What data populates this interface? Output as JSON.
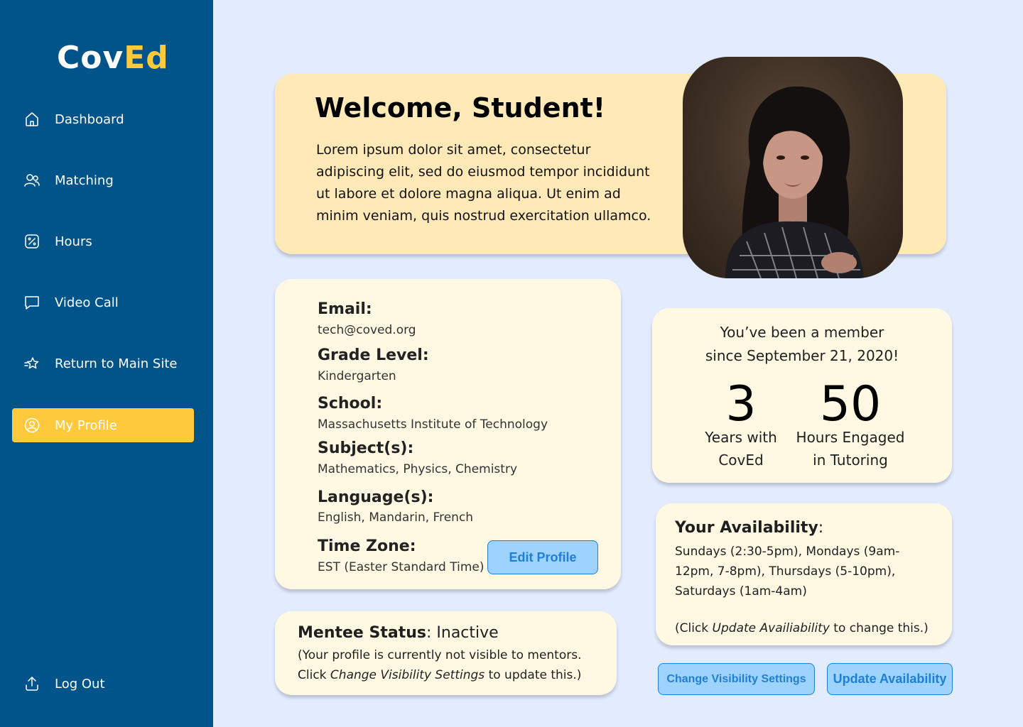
{
  "sidebar": {
    "logo": {
      "part1": "Cov",
      "part2": "Ed"
    },
    "items": [
      {
        "label": "Dashboard",
        "icon": "home-icon"
      },
      {
        "label": "Matching",
        "icon": "users-icon"
      },
      {
        "label": "Hours",
        "icon": "percent-icon"
      },
      {
        "label": "Video Call",
        "icon": "chat-icon"
      },
      {
        "label": "Return to Main Site",
        "icon": "star-icon"
      },
      {
        "label": "My Profile",
        "icon": "user-circle-icon",
        "active": true
      }
    ],
    "logout": {
      "label": "Log Out",
      "icon": "upload-icon"
    }
  },
  "welcome": {
    "title": "Welcome, Student!",
    "text": "Lorem ipsum dolor sit amet, consectetur adipiscing elit, sed do eiusmod tempor incididunt ut labore et dolore magna aliqua. Ut enim ad minim veniam, quis nostrud exercitation ullamco."
  },
  "profile": {
    "email_label": "Email:",
    "email": "tech@coved.org",
    "grade_label": "Grade Level:",
    "grade": "Kindergarten",
    "school_label": "School:",
    "school": "Massachusetts Institute of Technology",
    "subjects_label": "Subject(s):",
    "subjects": "Mathematics, Physics, Chemistry",
    "languages_label": "Language(s):",
    "languages": "English, Mandarin, French",
    "timezone_label": "Time Zone:",
    "timezone": "EST (Easter Standard Time)",
    "edit_button": "Edit Profile"
  },
  "status": {
    "label": "Mentee Status",
    "value": ": Inactive",
    "line1": "(Your profile is currently not visible to mentors.",
    "line2_pre": "Click ",
    "line2_em": "Change Visibility Settings",
    "line2_post": " to update this.)"
  },
  "member": {
    "line1": "You’ve been a member",
    "line2": "since September 21, 2020!",
    "years": "3",
    "years_cap1": "Years with",
    "years_cap2": "CovEd",
    "hours": "50",
    "hours_cap1": "Hours Engaged",
    "hours_cap2": "in Tutoring"
  },
  "availability": {
    "label": "Your Availability",
    "colon": ":",
    "text": "Sundays (2:30-5pm), Mondays (9am-12pm, 7-8pm), Thursdays (5-10pm), Saturdays (1am-4am)",
    "note_pre": "(Click ",
    "note_em": "Update Availiability",
    "note_post": " to change this.)"
  },
  "buttons": {
    "visibility": "Change Visibility Settings",
    "update": "Update Availability"
  },
  "colors": {
    "sidebar": "#00548a",
    "accent": "#ffc93c",
    "background": "#e3ebff",
    "button": "#9fd3ff",
    "button_text": "#1e7fd6"
  }
}
